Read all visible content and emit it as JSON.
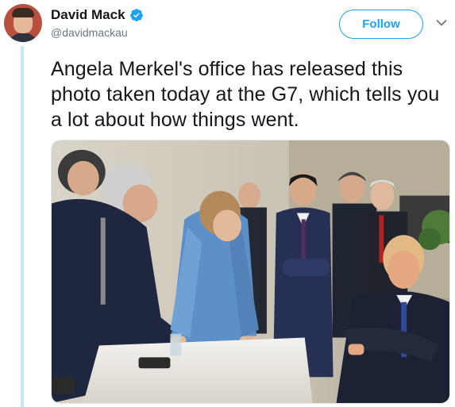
{
  "author": {
    "name": "David Mack",
    "handle": "@davidmackau",
    "verified": true
  },
  "actions": {
    "follow_label": "Follow",
    "menu_icon": "chevron-down-icon"
  },
  "tweet": {
    "text": "Angela Merkel's office has released this photo taken today at the G7, which tells you a lot about how things went."
  },
  "colors": {
    "accent": "#1da1f2",
    "thread_line": "#c4eaf6",
    "handle": "#657786",
    "text": "#14171a"
  }
}
